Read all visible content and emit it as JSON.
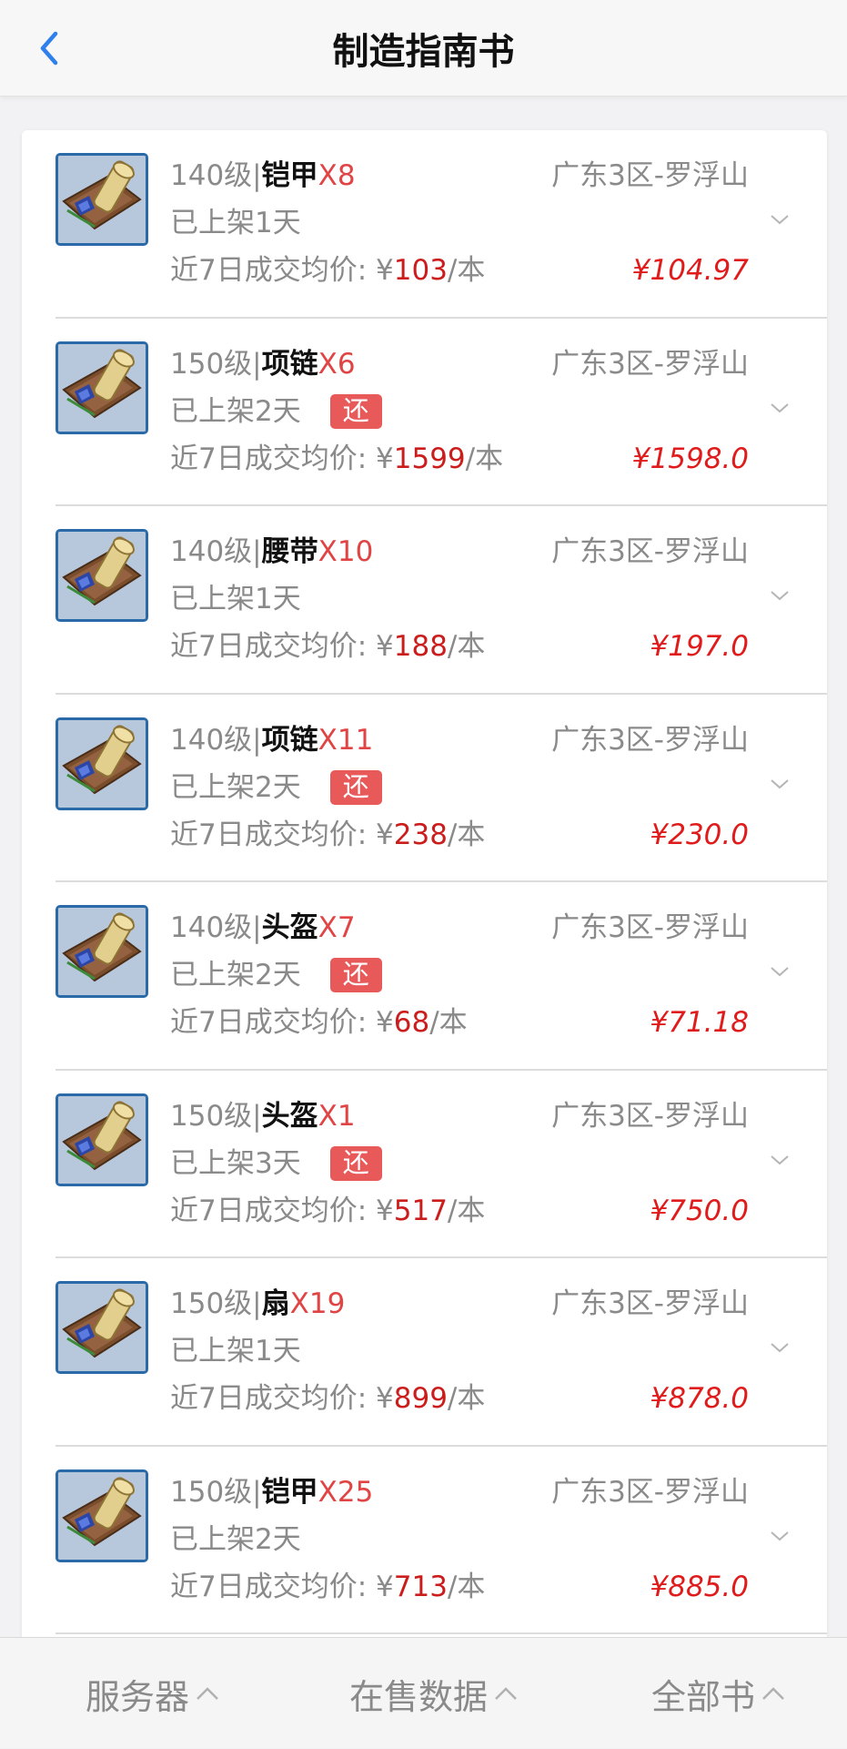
{
  "header": {
    "title": "制造指南书",
    "back_icon": "chevron-left-icon",
    "accent": "#2f80ed"
  },
  "list": [
    {
      "level": "140级",
      "item": "铠甲",
      "qty": "X8",
      "server": "广东3区-罗浮山",
      "listed": "已上架1天",
      "badge": "",
      "avg_prefix": "近7日成交均价: ¥",
      "avg": "103",
      "avg_suffix": "/本",
      "price": "¥104.97"
    },
    {
      "level": "150级",
      "item": "项链",
      "qty": "X6",
      "server": "广东3区-罗浮山",
      "listed": "已上架2天",
      "badge": "还",
      "avg_prefix": "近7日成交均价: ¥",
      "avg": "1599",
      "avg_suffix": "/本",
      "price": "¥1598.0"
    },
    {
      "level": "140级",
      "item": "腰带",
      "qty": "X10",
      "server": "广东3区-罗浮山",
      "listed": "已上架1天",
      "badge": "",
      "avg_prefix": "近7日成交均价: ¥",
      "avg": "188",
      "avg_suffix": "/本",
      "price": "¥197.0"
    },
    {
      "level": "140级",
      "item": "项链",
      "qty": "X11",
      "server": "广东3区-罗浮山",
      "listed": "已上架2天",
      "badge": "还",
      "avg_prefix": "近7日成交均价: ¥",
      "avg": "238",
      "avg_suffix": "/本",
      "price": "¥230.0"
    },
    {
      "level": "140级",
      "item": "头盔",
      "qty": "X7",
      "server": "广东3区-罗浮山",
      "listed": "已上架2天",
      "badge": "还",
      "avg_prefix": "近7日成交均价: ¥",
      "avg": "68",
      "avg_suffix": "/本",
      "price": "¥71.18"
    },
    {
      "level": "150级",
      "item": "头盔",
      "qty": "X1",
      "server": "广东3区-罗浮山",
      "listed": "已上架3天",
      "badge": "还",
      "avg_prefix": "近7日成交均价: ¥",
      "avg": "517",
      "avg_suffix": "/本",
      "price": "¥750.0"
    },
    {
      "level": "150级",
      "item": "扇",
      "qty": "X19",
      "server": "广东3区-罗浮山",
      "listed": "已上架1天",
      "badge": "",
      "avg_prefix": "近7日成交均价: ¥",
      "avg": "899",
      "avg_suffix": "/本",
      "price": "¥878.0"
    },
    {
      "level": "150级",
      "item": "铠甲",
      "qty": "X25",
      "server": "广东3区-罗浮山",
      "listed": "已上架2天",
      "badge": "",
      "avg_prefix": "近7日成交均价: ¥",
      "avg": "713",
      "avg_suffix": "/本",
      "price": "¥885.0"
    }
  ],
  "footer": {
    "tabs": [
      {
        "label": "服务器",
        "icon": "chevron-up-icon"
      },
      {
        "label": "在售数据",
        "icon": "chevron-up-icon"
      },
      {
        "label": "全部书",
        "icon": "chevron-up-icon"
      }
    ]
  },
  "colors": {
    "price_red": "#e01b1b",
    "qty_red": "#e04444",
    "badge_red": "#e85a5a",
    "muted": "#8a8a8a"
  }
}
